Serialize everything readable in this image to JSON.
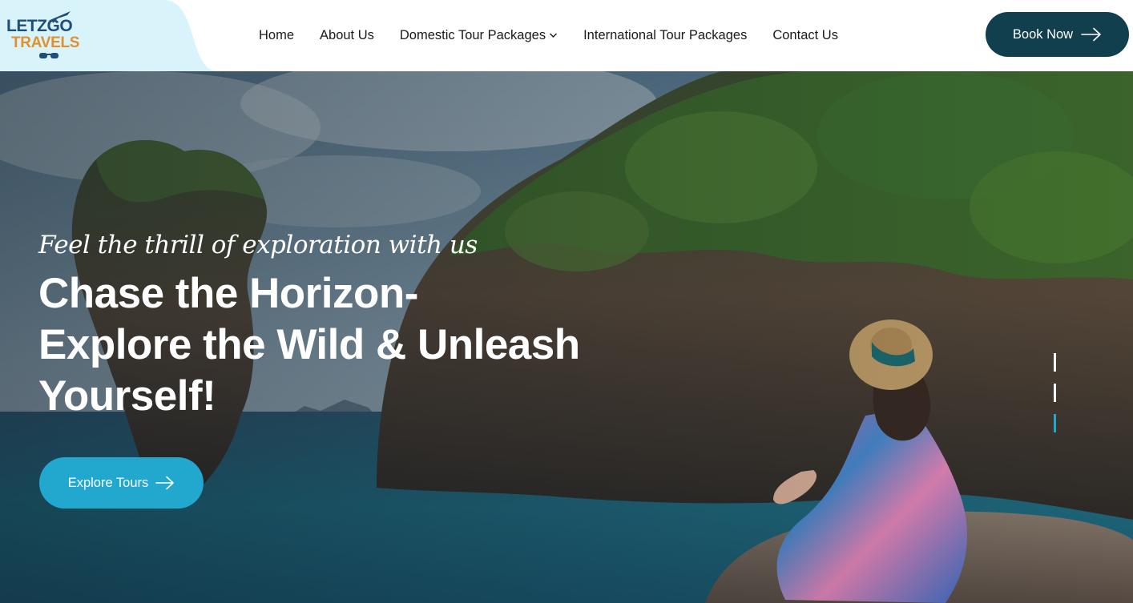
{
  "brand": {
    "logo_line1": "LETZGO",
    "logo_line2": "TRAVELS",
    "colors": {
      "logo_blue": "#1f4e79",
      "logo_orange": "#e0902f",
      "logo_bg": "#d9f3fb"
    }
  },
  "nav": {
    "items": [
      {
        "label": "Home"
      },
      {
        "label": "About Us"
      },
      {
        "label": "Domestic Tour Packages",
        "icon": "chevron-down-icon"
      },
      {
        "label": "International Tour Packages"
      },
      {
        "label": "Contact Us"
      }
    ]
  },
  "header": {
    "book_label": "Book Now",
    "book_icon": "arrow-right-icon",
    "book_color": "#123f4d"
  },
  "hero": {
    "tagline": "Feel the thrill of exploration with us",
    "headline_lines": [
      "Chase the Horizon-",
      "Explore the Wild & Unleash",
      "Yourself!"
    ],
    "cta_label": "Explore Tours",
    "cta_icon": "arrow-right-icon",
    "cta_color": "#22a7cf",
    "slides": {
      "count": 3,
      "active": 3
    }
  }
}
